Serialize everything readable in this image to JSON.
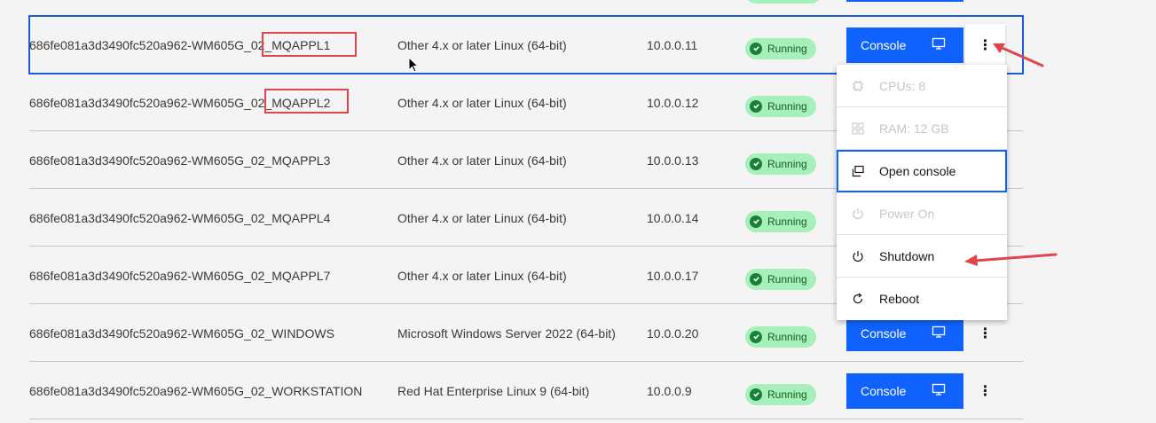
{
  "rows": [
    {
      "name": "686fe081a3d3490fc520a962-WM605G_02_MQAPPL1",
      "os": "Other 4.x or later Linux (64-bit)",
      "ip": "10.0.0.11",
      "status": "Running",
      "console_label": "Console"
    },
    {
      "name": "686fe081a3d3490fc520a962-WM605G_02_MQAPPL2",
      "os": "Other 4.x or later Linux (64-bit)",
      "ip": "10.0.0.12",
      "status": "Running",
      "console_label": "Console"
    },
    {
      "name": "686fe081a3d3490fc520a962-WM605G_02_MQAPPL3",
      "os": "Other 4.x or later Linux (64-bit)",
      "ip": "10.0.0.13",
      "status": "Running",
      "console_label": "Console"
    },
    {
      "name": "686fe081a3d3490fc520a962-WM605G_02_MQAPPL4",
      "os": "Other 4.x or later Linux (64-bit)",
      "ip": "10.0.0.14",
      "status": "Running",
      "console_label": "Console"
    },
    {
      "name": "686fe081a3d3490fc520a962-WM605G_02_MQAPPL7",
      "os": "Other 4.x or later Linux (64-bit)",
      "ip": "10.0.0.17",
      "status": "Running",
      "console_label": "Console"
    },
    {
      "name": "686fe081a3d3490fc520a962-WM605G_02_WINDOWS",
      "os": "Microsoft Windows Server 2022 (64-bit)",
      "ip": "10.0.0.20",
      "status": "Running",
      "console_label": "Console"
    },
    {
      "name": "686fe081a3d3490fc520a962-WM605G_02_WORKSTATION",
      "os": "Red Hat Enterprise Linux 9 (64-bit)",
      "ip": "10.0.0.9",
      "status": "Running",
      "console_label": "Console"
    }
  ],
  "overflow_menu": {
    "items": [
      {
        "label": "CPUs: 8",
        "icon": "cpu-icon",
        "disabled": true
      },
      {
        "label": "RAM: 12 GB",
        "icon": "memory-icon",
        "disabled": true
      },
      {
        "label": "Open console",
        "icon": "open-console-icon",
        "disabled": false,
        "focused": true
      },
      {
        "label": "Power On",
        "icon": "power-icon",
        "disabled": true
      },
      {
        "label": "Shutdown",
        "icon": "power-icon",
        "disabled": false
      },
      {
        "label": "Reboot",
        "icon": "restart-icon",
        "disabled": false
      }
    ]
  },
  "colors": {
    "primary": "#0f62fe",
    "status_bg": "#a7f0ba",
    "status_fg": "#0e6027",
    "annotation": "#e0454b",
    "selection": "#1f5ad6"
  }
}
